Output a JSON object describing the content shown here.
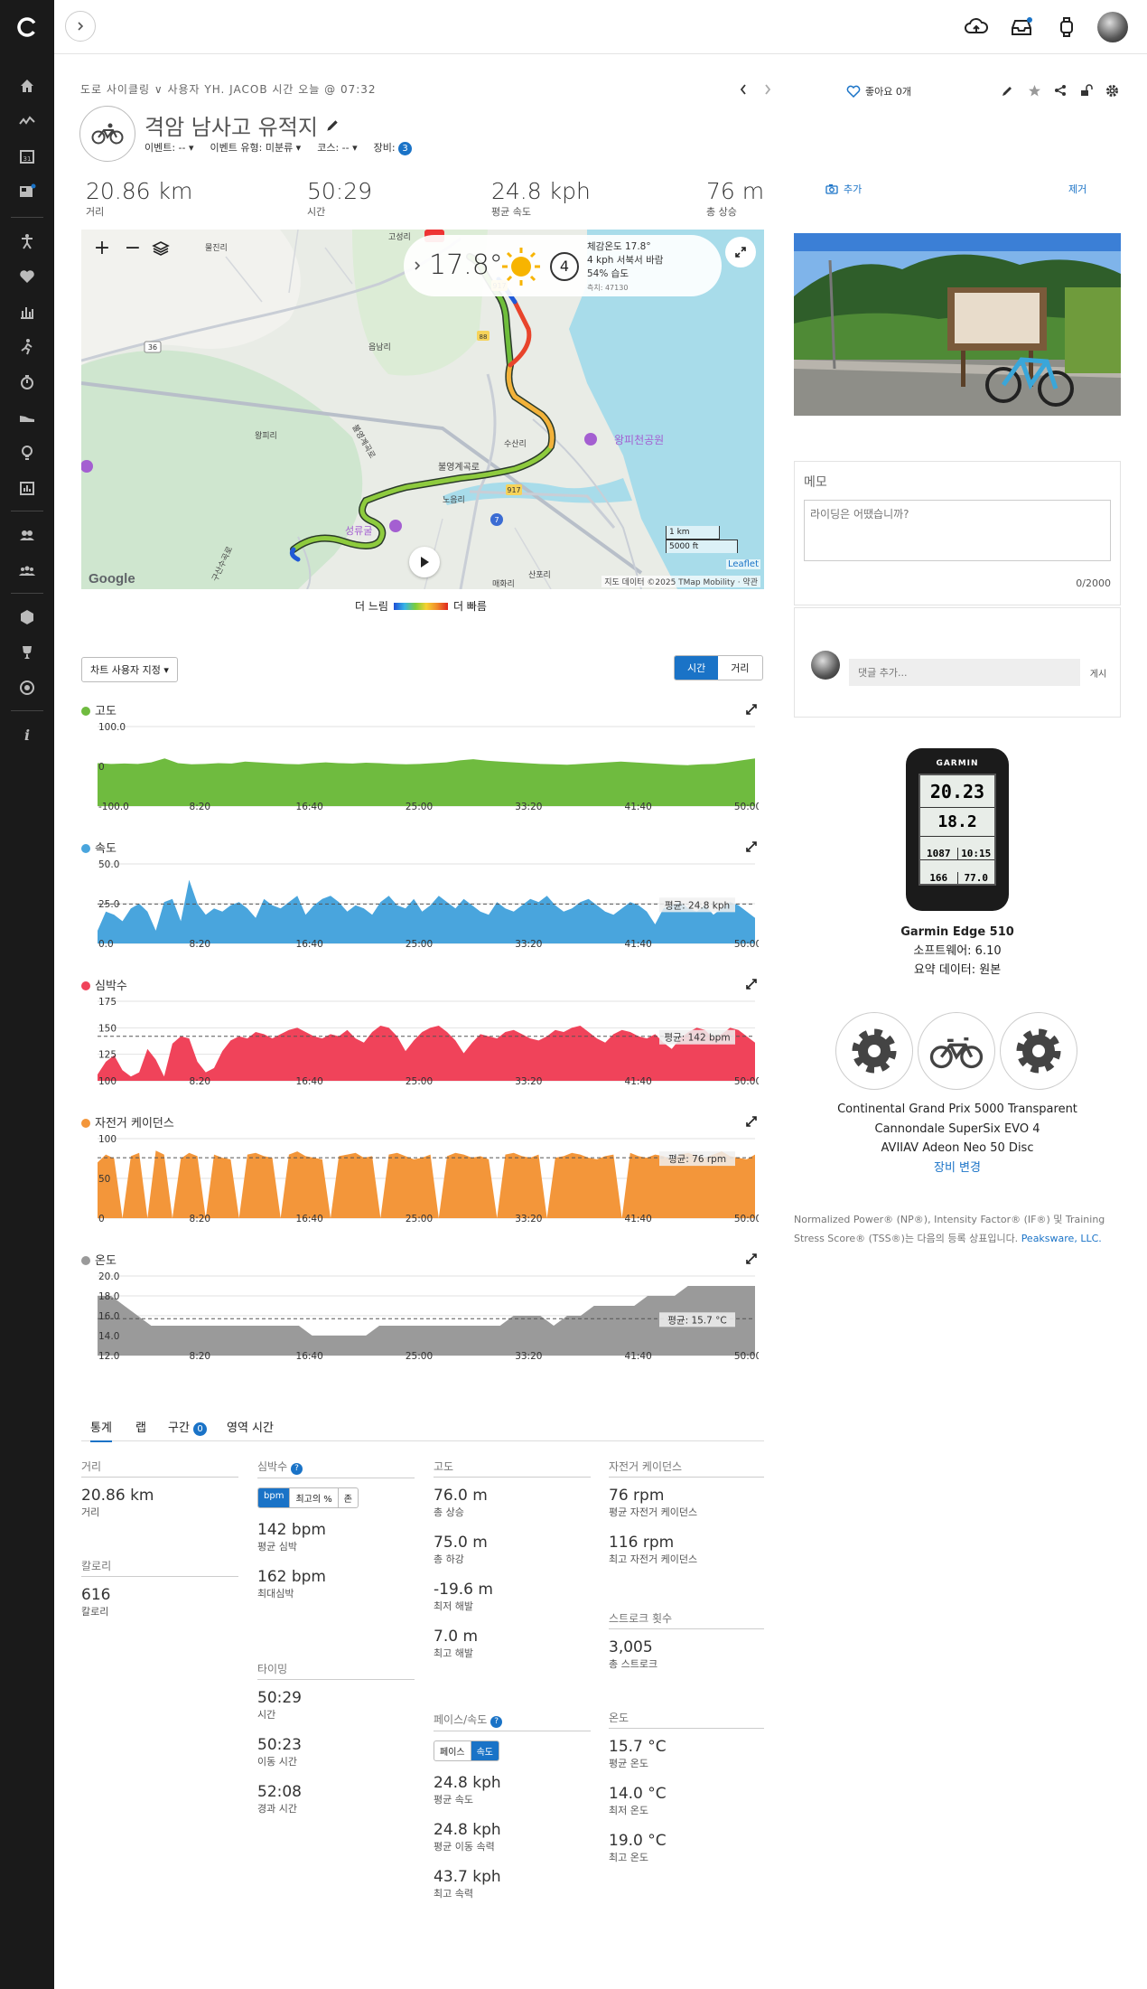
{
  "header": {
    "breadcrumb": "도로 사이클링 ∨ 사용자 YH. JACOB 시간 오늘 @ 07:32",
    "title": "격암 남사고 유적지",
    "event": "이벤트: -- ▾",
    "event_type": "이벤트 유형: 미분류 ▾",
    "course": "코스: -- ▾",
    "gear_label": "장비:",
    "gear_count": "3",
    "likes": "좋아요 0개"
  },
  "stats": [
    {
      "value": "20.86 km",
      "label": "거리"
    },
    {
      "value": "50:29",
      "label": "시간"
    },
    {
      "value": "24.8 kph",
      "label": "평균 속도"
    },
    {
      "value": "76 m",
      "label": "총 상승"
    }
  ],
  "map": {
    "temp": "17.8°",
    "wind_speed": "4",
    "feels": "체감온도 17.8°",
    "wind": "4 kph 서북서 바람",
    "humidity": "54% 습도",
    "station": "측치: 47130",
    "scale_km": "1 km",
    "scale_ft": "5000 ft",
    "leaflet": "Leaflet",
    "attribution": "지도 데이터 ©2025 TMap Mobility · 약관",
    "google": "Google",
    "places": [
      {
        "name": "왕피천공원"
      },
      {
        "name": "불영계곡로"
      },
      {
        "name": "수산리"
      },
      {
        "name": "노음리"
      },
      {
        "name": "불영계곡로"
      },
      {
        "name": "읍남리"
      },
      {
        "name": "물진리"
      },
      {
        "name": "고성리"
      },
      {
        "name": "왕피리"
      },
      {
        "name": "구산수곡로"
      },
      {
        "name": "성류굴"
      },
      {
        "name": "산포리"
      },
      {
        "name": "매화리"
      }
    ],
    "roads": [
      "36",
      "917",
      "7",
      "88",
      "917"
    ],
    "legend_slow": "더 느림",
    "legend_fast": "더 빠름"
  },
  "chart_controls": {
    "customize": "차트 사용자 지정 ▾",
    "time": "시간",
    "distance": "거리"
  },
  "chart_data": [
    {
      "type": "area",
      "title": "고도",
      "color": "#6fbb3f",
      "ylabels": [
        "100.0",
        "0",
        "-100.0"
      ],
      "x_ticks": [
        "8:20",
        "16:40",
        "25:00",
        "33:20",
        "41:40",
        "50:00"
      ],
      "avg": null,
      "series": [
        8,
        6,
        7,
        6,
        10,
        20,
        8,
        5,
        6,
        8,
        7,
        12,
        10,
        8,
        6,
        5,
        8,
        10,
        8,
        7,
        9,
        8,
        6,
        5,
        6,
        8,
        10,
        15,
        18,
        14,
        12,
        10,
        8,
        6,
        5,
        4,
        6,
        8,
        10,
        12,
        10,
        8,
        6,
        4,
        3,
        5,
        6,
        10,
        15,
        20
      ],
      "ymin": -100,
      "ymax": 100,
      "ylim": [
        -100,
        100
      ]
    },
    {
      "type": "area",
      "title": "속도",
      "color": "#49a5dd",
      "ylabels": [
        "50.0",
        "25.0",
        "0.0"
      ],
      "x_ticks": [
        "8:20",
        "16:40",
        "25:00",
        "33:20",
        "41:40",
        "50:00"
      ],
      "avg_label": "평균: 24.8 kph",
      "avg": 24.8,
      "series": [
        8,
        20,
        18,
        14,
        22,
        25,
        20,
        8,
        26,
        28,
        14,
        40,
        25,
        18,
        22,
        20,
        24,
        26,
        22,
        16,
        28,
        24,
        22,
        26,
        30,
        18,
        24,
        28,
        30,
        26,
        20,
        24,
        22,
        18,
        26,
        30,
        24,
        22,
        28,
        20,
        24,
        30,
        26,
        22,
        28,
        24,
        20,
        18,
        26,
        22,
        20,
        24,
        28,
        26,
        30,
        24,
        20,
        22,
        26,
        28,
        24,
        20,
        18,
        22,
        26,
        24,
        20,
        12,
        22,
        24,
        26,
        22,
        20,
        24,
        18,
        22,
        26,
        24,
        20,
        16
      ],
      "ymin": 0,
      "ymax": 50,
      "ylim": [
        0,
        50
      ]
    },
    {
      "type": "area",
      "title": "심박수",
      "color": "#f0435a",
      "ylabels": [
        "175",
        "150",
        "125",
        "100"
      ],
      "x_ticks": [
        "8:20",
        "16:40",
        "25:00",
        "33:20",
        "41:40",
        "50:00"
      ],
      "avg_label": "평균: 142 bpm",
      "avg": 142,
      "series": [
        106,
        118,
        124,
        110,
        104,
        108,
        130,
        120,
        104,
        135,
        142,
        140,
        118,
        108,
        112,
        128,
        138,
        142,
        140,
        146,
        144,
        140,
        144,
        148,
        150,
        146,
        142,
        140,
        144,
        142,
        148,
        140,
        136,
        146,
        152,
        150,
        142,
        128,
        138,
        146,
        150,
        152,
        146,
        138,
        126,
        136,
        144,
        142,
        140,
        146,
        148,
        144,
        140,
        138,
        142,
        148,
        146,
        150,
        152,
        146,
        140,
        136,
        144,
        148,
        146,
        142,
        140,
        144,
        136,
        130,
        140,
        146,
        150,
        148,
        140,
        144,
        150,
        148,
        142,
        136
      ],
      "ymin": 100,
      "ymax": 175,
      "ylim": [
        100,
        175
      ]
    },
    {
      "type": "area",
      "title": "자전거 케이던스",
      "color": "#f3963a",
      "ylabels": [
        "100",
        "50",
        "0"
      ],
      "x_ticks": [
        "8:20",
        "16:40",
        "25:00",
        "33:20",
        "41:40",
        "50:00"
      ],
      "avg_label": "평균: 76 rpm",
      "avg": 76,
      "series": [
        70,
        80,
        75,
        0,
        78,
        82,
        0,
        85,
        80,
        0,
        75,
        82,
        78,
        0,
        80,
        76,
        74,
        0,
        80,
        82,
        78,
        76,
        0,
        80,
        84,
        78,
        76,
        74,
        0,
        78,
        80,
        82,
        76,
        78,
        0,
        80,
        82,
        78,
        74,
        76,
        80,
        0,
        78,
        82,
        80,
        76,
        78,
        74,
        0,
        80,
        82,
        78,
        76,
        80,
        0,
        76,
        78,
        82,
        80,
        76,
        74,
        78,
        80,
        0,
        82,
        78,
        76,
        80,
        78,
        74,
        80,
        82,
        78,
        76,
        80,
        84,
        78,
        76,
        74,
        80
      ],
      "ymin": 0,
      "ymax": 100,
      "ylim": [
        0,
        100
      ]
    },
    {
      "type": "area",
      "title": "온도",
      "color": "#9a9a9a",
      "ylabels": [
        "20.0",
        "18.0",
        "16.0",
        "14.0",
        "12.0"
      ],
      "x_ticks": [
        "8:20",
        "16:40",
        "25:00",
        "33:20",
        "41:40",
        "50:00"
      ],
      "avg_label": "평균: 15.7 °C",
      "avg": 15.7,
      "series": [
        18,
        18,
        17,
        16,
        15,
        15,
        15,
        15,
        15,
        15,
        15,
        15,
        15,
        15,
        15,
        15,
        14,
        14,
        14,
        14,
        14,
        15,
        15,
        15,
        15,
        15,
        15,
        15,
        15,
        15,
        15,
        16,
        16,
        16,
        15,
        16,
        16,
        17,
        17,
        17,
        17,
        18,
        18,
        18,
        19,
        19,
        19,
        19,
        19,
        19
      ],
      "ymin": 12,
      "ymax": 20,
      "ylim": [
        12,
        20
      ]
    }
  ],
  "tabs": {
    "stats": "통계",
    "laps": "랩",
    "segments": "구간",
    "segments_count": "0",
    "zones": "영역 시간"
  },
  "blocks": {
    "distance": {
      "title": "거리",
      "value": "20.86 km",
      "label": "거리"
    },
    "calories": {
      "title": "칼로리",
      "value": "616",
      "label": "칼로리"
    },
    "hr": {
      "title": "심박수",
      "seg": [
        "bpm",
        "최고의 %",
        "존"
      ],
      "avg": "142 bpm",
      "avg_label": "평균 심박",
      "max": "162 bpm",
      "max_label": "최대심박"
    },
    "timing": {
      "title": "타이밍",
      "t1": "50:29",
      "l1": "시간",
      "t2": "50:23",
      "l2": "이동 시간",
      "t3": "52:08",
      "l3": "경과 시간"
    },
    "elev": {
      "title": "고도",
      "v1": "76.0 m",
      "l1": "총 상승",
      "v2": "75.0 m",
      "l2": "총 하강",
      "v3": "-19.6 m",
      "l3": "최저 해발",
      "v4": "7.0 m",
      "l4": "최고 해발"
    },
    "pace": {
      "title": "페이스/속도",
      "seg": [
        "페이스",
        "속도"
      ],
      "v1": "24.8 kph",
      "l1": "평균 속도",
      "v2": "24.8 kph",
      "l2": "평균 이동 속력",
      "v3": "43.7 kph",
      "l3": "최고 속력"
    },
    "cad": {
      "title": "자전거 케이던스",
      "v1": "76 rpm",
      "l1": "평균 자전거 케이던스",
      "v2": "116 rpm",
      "l2": "최고 자전거 케이던스"
    },
    "strokes": {
      "title": "스트로크 횟수",
      "v1": "3,005",
      "l1": "총 스트로크"
    },
    "temp": {
      "title": "온도",
      "v1": "15.7 °C",
      "l1": "평균 온도",
      "v2": "14.0 °C",
      "l2": "최저 온도",
      "v3": "19.0 °C",
      "l3": "최고 온도"
    }
  },
  "right": {
    "add_photo": "추가",
    "remove": "제거",
    "memo_title": "메모",
    "memo_placeholder": "라이딩은 어땠습니까?",
    "memo_count": "0/2000",
    "comment_placeholder": "댓글 추가...",
    "post": "게시",
    "device": {
      "brand": "GARMIN",
      "name": "Garmin Edge 510",
      "sw": "소프트웨어: 6.10",
      "summary": "요약 데이터: 원본",
      "v1": "20.23",
      "v2": "18.2",
      "v3": "1087",
      "v4": "10:15",
      "v5": "166",
      "v6": "77.0"
    },
    "gear": [
      "Continental Grand Prix 5000 Transparent",
      "Cannondale SuperSix EVO 4",
      "AVIIAV Adeon Neo 50 Disc"
    ],
    "gear_change": "장비 변경",
    "trademark": "Normalized Power® (NP®), Intensity Factor® (IF®) 및 Training Stress Score® (TSS®)는 다음의 등록 상표입니다.",
    "peaksware": "Peaksware, LLC."
  }
}
